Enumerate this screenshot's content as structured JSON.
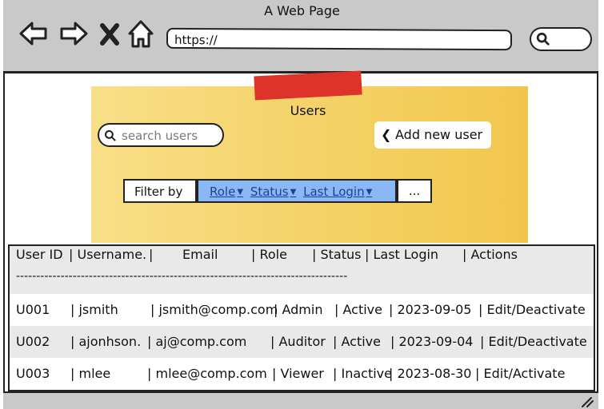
{
  "window": {
    "title": "A Web Page"
  },
  "browser": {
    "url": "https://",
    "icons": [
      "back-arrow-icon",
      "forward-arrow-icon",
      "close-x-icon",
      "home-icon",
      "search-icon"
    ]
  },
  "panel": {
    "title": "Users",
    "search_placeholder": "search users",
    "add_user_label": "Add new user",
    "filter_label": "Filter by",
    "filters": [
      "Role",
      "Status",
      "Last Login"
    ],
    "more_label": "...",
    "tape_color": "#dd332b",
    "note_color": "#f4d063"
  },
  "table": {
    "headers": [
      "User ID",
      "| Username.",
      "|",
      "Email",
      "| Role",
      "| Status",
      "| Last Login",
      "| Actions"
    ],
    "separator": "----------------------------------------------------------------------------------",
    "rows": [
      {
        "id": "U001",
        "username": "| jsmith",
        "email": "| jsmith@comp.com",
        "role": "| Admin",
        "status": "| Active",
        "last_login": "| 2023-09-05",
        "actions": "| Edit/Deactivate"
      },
      {
        "id": "U002",
        "username": "| ajonhson.",
        "email": "| aj@comp.com",
        "role": "| Auditor",
        "status": "| Active",
        "last_login": "| 2023-09-04",
        "actions": "| Edit/Deactivate"
      },
      {
        "id": "U003",
        "username": "| mlee",
        "email": "| mlee@comp.com",
        "role": "| Viewer",
        "status": "| Inactive",
        "last_login": "| 2023-08-30",
        "actions": "| Edit/Activate"
      }
    ]
  }
}
